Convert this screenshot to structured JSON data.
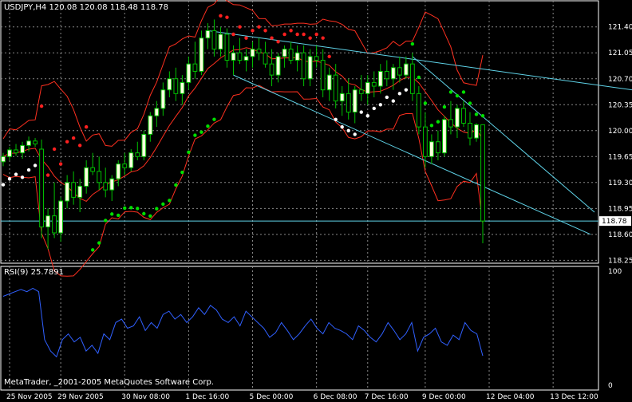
{
  "chart_data": [
    {
      "panel": "price",
      "type": "candlestick",
      "title": "USDJPY,H4  120.08 120.08 118.48 118.78",
      "y_ticks": [
        "121.40",
        "121.05",
        "120.70",
        "120.35",
        "120.00",
        "119.65",
        "119.30",
        "118.95",
        "118.60",
        "118.25"
      ],
      "ylim": [
        118.2,
        121.58
      ],
      "last_price": "118.78",
      "grid": true,
      "candles": [
        {
          "o": 119.58,
          "h": 119.7,
          "l": 119.52,
          "c": 119.65
        },
        {
          "o": 119.65,
          "h": 119.78,
          "l": 119.6,
          "c": 119.74
        },
        {
          "o": 119.74,
          "h": 119.82,
          "l": 119.66,
          "c": 119.7
        },
        {
          "o": 119.7,
          "h": 119.85,
          "l": 119.62,
          "c": 119.8
        },
        {
          "o": 119.8,
          "h": 119.92,
          "l": 119.72,
          "c": 119.86
        },
        {
          "o": 119.86,
          "h": 119.9,
          "l": 119.78,
          "c": 119.82
        },
        {
          "o": 119.75,
          "h": 119.88,
          "l": 118.55,
          "c": 118.7
        },
        {
          "o": 118.7,
          "h": 118.95,
          "l": 118.4,
          "c": 118.85
        },
        {
          "o": 118.85,
          "h": 119.3,
          "l": 118.55,
          "c": 118.62
        },
        {
          "o": 118.62,
          "h": 119.1,
          "l": 118.5,
          "c": 119.05
        },
        {
          "o": 119.05,
          "h": 119.4,
          "l": 118.95,
          "c": 119.3
        },
        {
          "o": 119.3,
          "h": 119.45,
          "l": 119.0,
          "c": 119.1
        },
        {
          "o": 119.1,
          "h": 119.35,
          "l": 118.9,
          "c": 119.25
        },
        {
          "o": 119.25,
          "h": 119.6,
          "l": 119.15,
          "c": 119.5
        },
        {
          "o": 119.5,
          "h": 119.7,
          "l": 119.4,
          "c": 119.45
        },
        {
          "o": 119.45,
          "h": 119.65,
          "l": 119.2,
          "c": 119.3
        },
        {
          "o": 119.3,
          "h": 119.5,
          "l": 119.1,
          "c": 119.2
        },
        {
          "o": 119.2,
          "h": 119.4,
          "l": 119.05,
          "c": 119.35
        },
        {
          "o": 119.35,
          "h": 119.6,
          "l": 119.25,
          "c": 119.55
        },
        {
          "o": 119.55,
          "h": 119.7,
          "l": 119.4,
          "c": 119.5
        },
        {
          "o": 119.5,
          "h": 119.75,
          "l": 119.45,
          "c": 119.7
        },
        {
          "o": 119.7,
          "h": 119.85,
          "l": 119.6,
          "c": 119.65
        },
        {
          "o": 119.65,
          "h": 120.0,
          "l": 119.6,
          "c": 119.95
        },
        {
          "o": 119.95,
          "h": 120.25,
          "l": 119.85,
          "c": 120.2
        },
        {
          "o": 120.2,
          "h": 120.4,
          "l": 120.05,
          "c": 120.3
        },
        {
          "o": 120.3,
          "h": 120.65,
          "l": 120.2,
          "c": 120.55
        },
        {
          "o": 120.55,
          "h": 120.8,
          "l": 120.45,
          "c": 120.7
        },
        {
          "o": 120.7,
          "h": 120.85,
          "l": 120.4,
          "c": 120.5
        },
        {
          "o": 120.5,
          "h": 120.75,
          "l": 120.35,
          "c": 120.65
        },
        {
          "o": 120.65,
          "h": 121.0,
          "l": 120.55,
          "c": 120.9
        },
        {
          "o": 120.9,
          "h": 121.2,
          "l": 120.7,
          "c": 120.8
        },
        {
          "o": 120.8,
          "h": 121.35,
          "l": 120.75,
          "c": 121.25
        },
        {
          "o": 121.25,
          "h": 121.45,
          "l": 121.1,
          "c": 121.35
        },
        {
          "o": 121.35,
          "h": 121.5,
          "l": 121.0,
          "c": 121.1
        },
        {
          "o": 121.1,
          "h": 121.4,
          "l": 121.0,
          "c": 121.3
        },
        {
          "o": 121.3,
          "h": 121.38,
          "l": 120.85,
          "c": 120.95
        },
        {
          "o": 120.95,
          "h": 121.15,
          "l": 120.75,
          "c": 121.05
        },
        {
          "o": 121.05,
          "h": 121.25,
          "l": 120.9,
          "c": 120.95
        },
        {
          "o": 120.95,
          "h": 121.1,
          "l": 120.8,
          "c": 121.0
        },
        {
          "o": 121.0,
          "h": 121.2,
          "l": 120.85,
          "c": 121.1
        },
        {
          "o": 121.1,
          "h": 121.25,
          "l": 120.95,
          "c": 121.05
        },
        {
          "o": 121.05,
          "h": 121.2,
          "l": 120.85,
          "c": 120.9
        },
        {
          "o": 120.9,
          "h": 121.1,
          "l": 120.6,
          "c": 120.75
        },
        {
          "o": 120.75,
          "h": 121.05,
          "l": 120.65,
          "c": 121.0
        },
        {
          "o": 121.0,
          "h": 121.15,
          "l": 120.85,
          "c": 121.1
        },
        {
          "o": 121.1,
          "h": 121.2,
          "l": 120.9,
          "c": 120.95
        },
        {
          "o": 120.95,
          "h": 121.15,
          "l": 120.8,
          "c": 121.05
        },
        {
          "o": 121.05,
          "h": 121.15,
          "l": 120.6,
          "c": 120.7
        },
        {
          "o": 120.7,
          "h": 121.1,
          "l": 120.6,
          "c": 121.0
        },
        {
          "o": 121.0,
          "h": 121.15,
          "l": 120.85,
          "c": 120.95
        },
        {
          "o": 120.95,
          "h": 121.1,
          "l": 120.45,
          "c": 120.55
        },
        {
          "o": 120.55,
          "h": 120.85,
          "l": 120.4,
          "c": 120.75
        },
        {
          "o": 120.75,
          "h": 120.9,
          "l": 120.3,
          "c": 120.4
        },
        {
          "o": 120.4,
          "h": 120.6,
          "l": 120.2,
          "c": 120.5
        },
        {
          "o": 120.5,
          "h": 120.7,
          "l": 120.15,
          "c": 120.25
        },
        {
          "o": 120.25,
          "h": 120.6,
          "l": 120.1,
          "c": 120.55
        },
        {
          "o": 120.55,
          "h": 120.75,
          "l": 120.4,
          "c": 120.5
        },
        {
          "o": 120.5,
          "h": 120.75,
          "l": 120.35,
          "c": 120.65
        },
        {
          "o": 120.65,
          "h": 120.8,
          "l": 120.45,
          "c": 120.6
        },
        {
          "o": 120.6,
          "h": 120.9,
          "l": 120.5,
          "c": 120.8
        },
        {
          "o": 120.8,
          "h": 120.95,
          "l": 120.6,
          "c": 120.7
        },
        {
          "o": 120.7,
          "h": 120.9,
          "l": 120.55,
          "c": 120.85
        },
        {
          "o": 120.85,
          "h": 121.0,
          "l": 120.65,
          "c": 120.75
        },
        {
          "o": 120.75,
          "h": 121.0,
          "l": 120.7,
          "c": 120.9
        },
        {
          "o": 120.9,
          "h": 121.05,
          "l": 120.4,
          "c": 120.5
        },
        {
          "o": 120.5,
          "h": 120.6,
          "l": 119.95,
          "c": 120.05
        },
        {
          "o": 120.05,
          "h": 120.25,
          "l": 119.5,
          "c": 119.65
        },
        {
          "o": 119.65,
          "h": 119.95,
          "l": 119.55,
          "c": 119.85
        },
        {
          "o": 119.85,
          "h": 120.0,
          "l": 119.6,
          "c": 119.7
        },
        {
          "o": 119.7,
          "h": 120.2,
          "l": 119.65,
          "c": 120.15
        },
        {
          "o": 120.15,
          "h": 120.4,
          "l": 119.95,
          "c": 120.05
        },
        {
          "o": 120.05,
          "h": 120.35,
          "l": 119.9,
          "c": 120.3
        },
        {
          "o": 120.3,
          "h": 120.4,
          "l": 120.05,
          "c": 120.1
        },
        {
          "o": 120.1,
          "h": 120.25,
          "l": 119.8,
          "c": 119.9
        },
        {
          "o": 119.9,
          "h": 120.1,
          "l": 119.85,
          "c": 120.08
        },
        {
          "o": 120.08,
          "h": 120.08,
          "l": 118.48,
          "c": 118.78
        }
      ],
      "x_tick_labels": [
        {
          "idx": 1,
          "label": "25 Nov 2005"
        },
        {
          "idx": 9,
          "label": "29 Nov 2005"
        },
        {
          "idx": 19,
          "label": "30 Nov 08:00"
        },
        {
          "idx": 29,
          "label": "1 Dec 16:00"
        },
        {
          "idx": 39,
          "label": "5 Dec 00:00"
        },
        {
          "idx": 49,
          "label": "6 Dec 08:00"
        },
        {
          "idx": 57,
          "label": "7 Dec 16:00"
        },
        {
          "idx": 66,
          "label": "9 Dec 00:00"
        },
        {
          "idx": 76,
          "label": "12 Dec 04:00"
        },
        {
          "idx": 86,
          "label": "13 Dec 12:00"
        }
      ],
      "colors": {
        "up": "#00c000",
        "down": "#000000",
        "candle_body_up": "#ffffe0",
        "border": "#ffffff",
        "grid": "#888888",
        "band": "#ff3020",
        "channel": "#5fd3e8",
        "sar_up": "#00e000",
        "sar_down": "#ff2020",
        "sar_white": "#ffffff"
      }
    },
    {
      "panel": "indicator",
      "type": "line",
      "title": "RSI(9) 25.7891",
      "y_ticks": [
        "100",
        "0"
      ],
      "ylim": [
        0,
        100
      ],
      "series": [
        {
          "values": [
            78,
            80,
            82,
            84,
            82,
            85,
            82,
            40,
            30,
            25,
            40,
            45,
            38,
            42,
            30,
            35,
            28,
            45,
            40,
            55,
            58,
            50,
            52,
            60,
            48,
            55,
            50,
            62,
            65,
            58,
            62,
            55,
            60,
            68,
            62,
            70,
            66,
            58,
            55,
            60,
            52,
            65,
            60,
            55,
            50,
            42,
            46,
            55,
            48,
            40,
            45,
            52,
            58,
            50,
            45,
            55,
            50,
            48,
            45,
            40,
            52,
            48,
            42,
            38,
            45,
            55,
            48,
            40,
            45,
            55,
            30,
            42,
            45,
            50,
            38,
            35,
            44,
            40,
            55,
            48,
            45,
            25.79
          ]
        }
      ],
      "color": "#3060ff"
    }
  ],
  "footer_text": "MetaTrader, _2001-2005 MetaQuotes Software Corp."
}
